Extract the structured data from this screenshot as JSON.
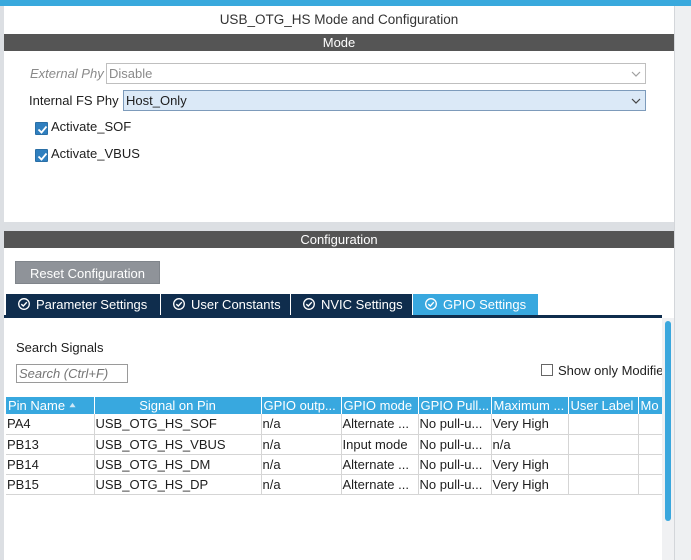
{
  "window": {
    "title": "USB_OTG_HS Mode and Configuration"
  },
  "mode": {
    "section_label": "Mode",
    "external_phy": {
      "label": "External Phy",
      "value": "Disable"
    },
    "internal_fs_phy": {
      "label": "Internal FS Phy",
      "value": "Host_Only"
    },
    "checkboxes": [
      {
        "label": "Activate_SOF",
        "checked": true
      },
      {
        "label": "Activate_VBUS",
        "checked": true
      }
    ]
  },
  "configuration": {
    "section_label": "Configuration",
    "reset_label": "Reset Configuration",
    "tabs": [
      {
        "label": "Parameter Settings",
        "active": false
      },
      {
        "label": "User Constants",
        "active": false
      },
      {
        "label": "NVIC Settings",
        "active": false
      },
      {
        "label": "GPIO Settings",
        "active": true
      }
    ]
  },
  "gpio": {
    "search_label": "Search Signals",
    "search_placeholder": "Search (Ctrl+F)",
    "show_only_label": "Show only Modified",
    "columns": [
      "Pin Name",
      "Signal on Pin",
      "GPIO outp...",
      "GPIO mode",
      "GPIO Pull...",
      "Maximum ...",
      "User Label",
      "Mo"
    ],
    "rows": [
      [
        "PA4",
        "USB_OTG_HS_SOF",
        "n/a",
        "Alternate ...",
        "No pull-u...",
        "Very High",
        "",
        ""
      ],
      [
        "PB13",
        "USB_OTG_HS_VBUS",
        "n/a",
        "Input mode",
        "No pull-u...",
        "n/a",
        "",
        ""
      ],
      [
        "PB14",
        "USB_OTG_HS_DM",
        "n/a",
        "Alternate ...",
        "No pull-u...",
        "Very High",
        "",
        ""
      ],
      [
        "PB15",
        "USB_OTG_HS_DP",
        "n/a",
        "Alternate ...",
        "No pull-u...",
        "Very High",
        "",
        ""
      ]
    ]
  },
  "colors": {
    "accent_blue": "#38a8df",
    "tab_navy": "#0f2d4d",
    "section_bar": "#555555",
    "checkbox_blue": "#2f7fbf"
  }
}
